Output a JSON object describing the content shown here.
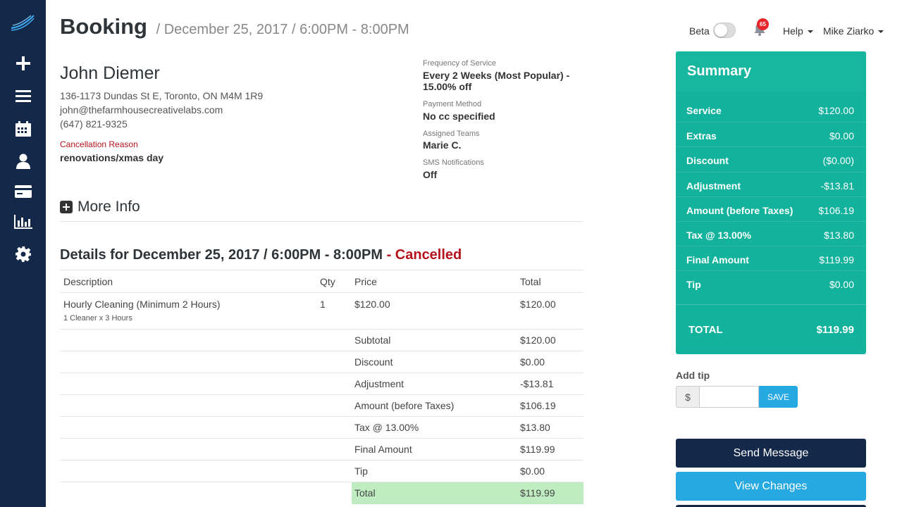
{
  "header": {
    "title": "Booking",
    "subtitle": "/ December 25, 2017 / 6:00PM - 8:00PM"
  },
  "topbar": {
    "beta_label": "Beta",
    "notification_count": "65",
    "help_label": "Help",
    "user_name": "Mike Ziarko"
  },
  "sidebar": {
    "items": [
      {
        "icon": "plus-icon"
      },
      {
        "icon": "menu-icon"
      },
      {
        "icon": "calendar-icon"
      },
      {
        "icon": "user-icon"
      },
      {
        "icon": "credit-card-icon"
      },
      {
        "icon": "bar-chart-icon"
      },
      {
        "icon": "gear-icon"
      }
    ]
  },
  "customer": {
    "name": "John Diemer",
    "address": "136-1173 Dundas St E, Toronto, ON M4M 1R9",
    "email": "john@thefarmhousecreativelabs.com",
    "phone": "(647) 821-9325",
    "cancellation_label": "Cancellation Reason",
    "cancellation_reason": "renovations/xmas day"
  },
  "meta": {
    "frequency_label": "Frequency of Service",
    "frequency_value": "Every 2 Weeks (Most Popular) - 15.00% off",
    "payment_label": "Payment Method",
    "payment_value": "No cc specified",
    "teams_label": "Assigned Teams",
    "teams_value": "Marie C.",
    "sms_label": "SMS Notifications",
    "sms_value": "Off"
  },
  "more_info_label": "More Info",
  "details": {
    "title": "Details for December 25, 2017 / 6:00PM - 8:00PM",
    "status": "- Cancelled"
  },
  "table": {
    "headers": {
      "description": "Description",
      "qty": "Qty",
      "price": "Price",
      "total": "Total"
    },
    "item": {
      "description": "Hourly Cleaning (Minimum 2 Hours)",
      "sub": "1 Cleaner x 3 Hours",
      "qty": "1",
      "price": "$120.00",
      "total": "$120.00"
    },
    "summary_rows": [
      {
        "label": "Subtotal",
        "value": "$120.00"
      },
      {
        "label": "Discount",
        "value": "$0.00"
      },
      {
        "label": "Adjustment",
        "value": "-$13.81"
      },
      {
        "label": "Amount (before Taxes)",
        "value": "$106.19"
      },
      {
        "label": "Tax @ 13.00%",
        "value": "$13.80"
      },
      {
        "label": "Final Amount",
        "value": "$119.99"
      },
      {
        "label": "Tip",
        "value": "$0.00"
      },
      {
        "label": "Total",
        "value": "$119.99"
      }
    ]
  },
  "summary": {
    "title": "Summary",
    "rows": [
      {
        "label": "Service",
        "value": "$120.00"
      },
      {
        "label": "Extras",
        "value": "$0.00"
      },
      {
        "label": "Discount",
        "value": "($0.00)"
      },
      {
        "label": "Adjustment",
        "value": "-$13.81"
      },
      {
        "label": "Amount (before Taxes)",
        "value": "$106.19"
      },
      {
        "label": "Tax @ 13.00%",
        "value": "$13.80"
      },
      {
        "label": "Final Amount",
        "value": "$119.99"
      },
      {
        "label": "Tip",
        "value": "$0.00"
      }
    ],
    "total_label": "TOTAL",
    "total_value": "$119.99"
  },
  "tip": {
    "label": "Add tip",
    "currency": "$",
    "value": "",
    "save_label": "SAVE"
  },
  "actions": {
    "send_message": "Send Message",
    "view_changes": "View Changes"
  },
  "colors": {
    "sidebar": "#142849",
    "summary": "#12b29d",
    "accent_blue": "#26a9e0",
    "cancelled": "#b5121b",
    "total_highlight": "#bfedc1"
  }
}
